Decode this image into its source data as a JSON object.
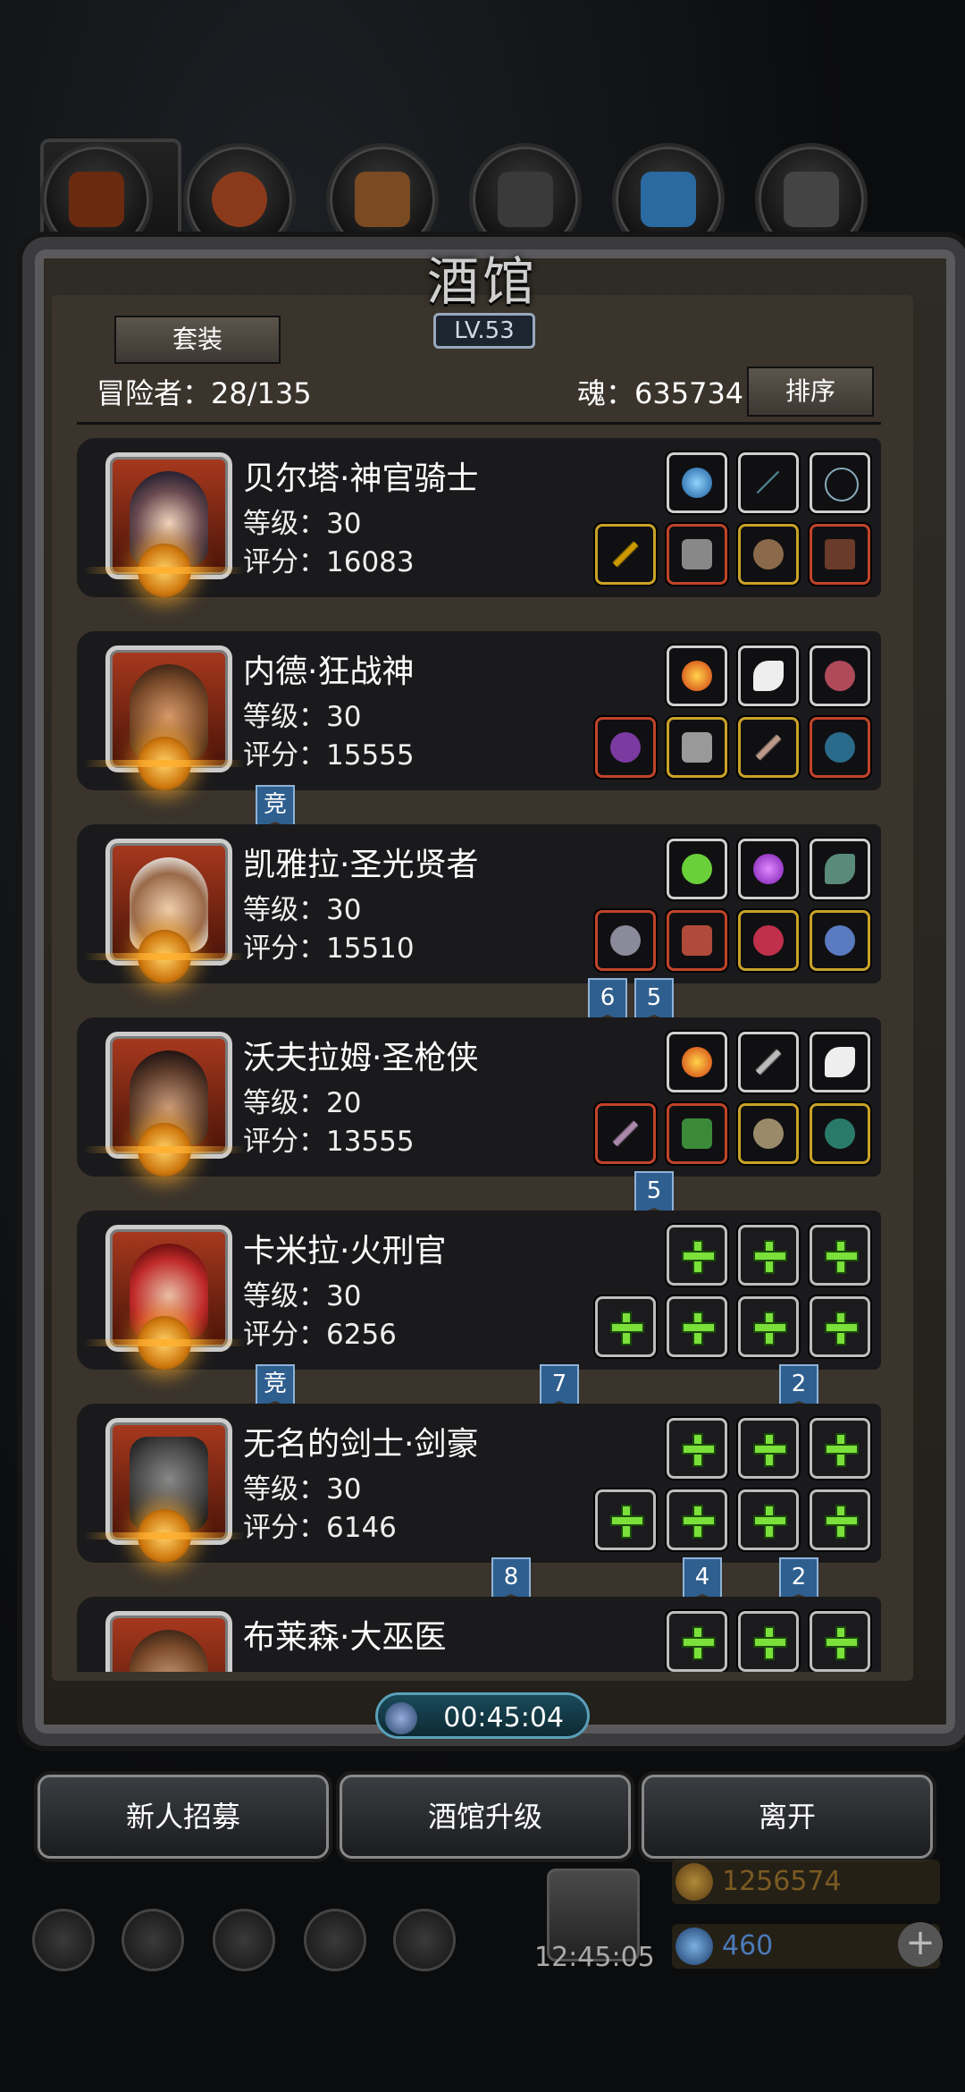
{
  "header": {
    "title": "酒馆",
    "level": "LV.53",
    "suit_button": "套装",
    "adventurers": "冒险者：28/135",
    "soul": "魂：635734",
    "sort_button": "排序"
  },
  "heroes": [
    {
      "name": "贝尔塔·神官骑士",
      "level": "等级：30",
      "score": "评分：16083"
    },
    {
      "name": "内德·狂战神",
      "level": "等级：30",
      "score": "评分：15555"
    },
    {
      "name": "凯雅拉·圣光贤者",
      "level": "等级：30",
      "score": "评分：15510"
    },
    {
      "name": "沃夫拉姆·圣枪侠",
      "level": "等级：20",
      "score": "评分：13555"
    },
    {
      "name": "卡米拉·火刑官",
      "level": "等级：30",
      "score": "评分：6256"
    },
    {
      "name": "无名的剑士·剑豪",
      "level": "等级：30",
      "score": "评分：6146"
    },
    {
      "name": "布莱森·大巫医",
      "level": "",
      "score": ""
    }
  ],
  "ribbons": {
    "r1": "竞",
    "r2a": "6",
    "r2b": "5",
    "r3": "5",
    "r4a": "竞",
    "r4b": "7",
    "r4c": "2",
    "r5a": "8",
    "r5b": "4",
    "r5c": "2"
  },
  "timer": "00:45:04",
  "bottom_buttons": {
    "recruit": "新人招募",
    "upgrade": "酒馆升级",
    "leave": "离开"
  },
  "hud": {
    "gift_time": "12:45:05",
    "gold": "1256574",
    "gems": "460",
    "plus": "+"
  },
  "colors": {
    "accent_blue": "#2f5f8f",
    "plus_green": "#7be03a",
    "gold_text": "#c9a227",
    "gem_text": "#4a7ab8"
  }
}
